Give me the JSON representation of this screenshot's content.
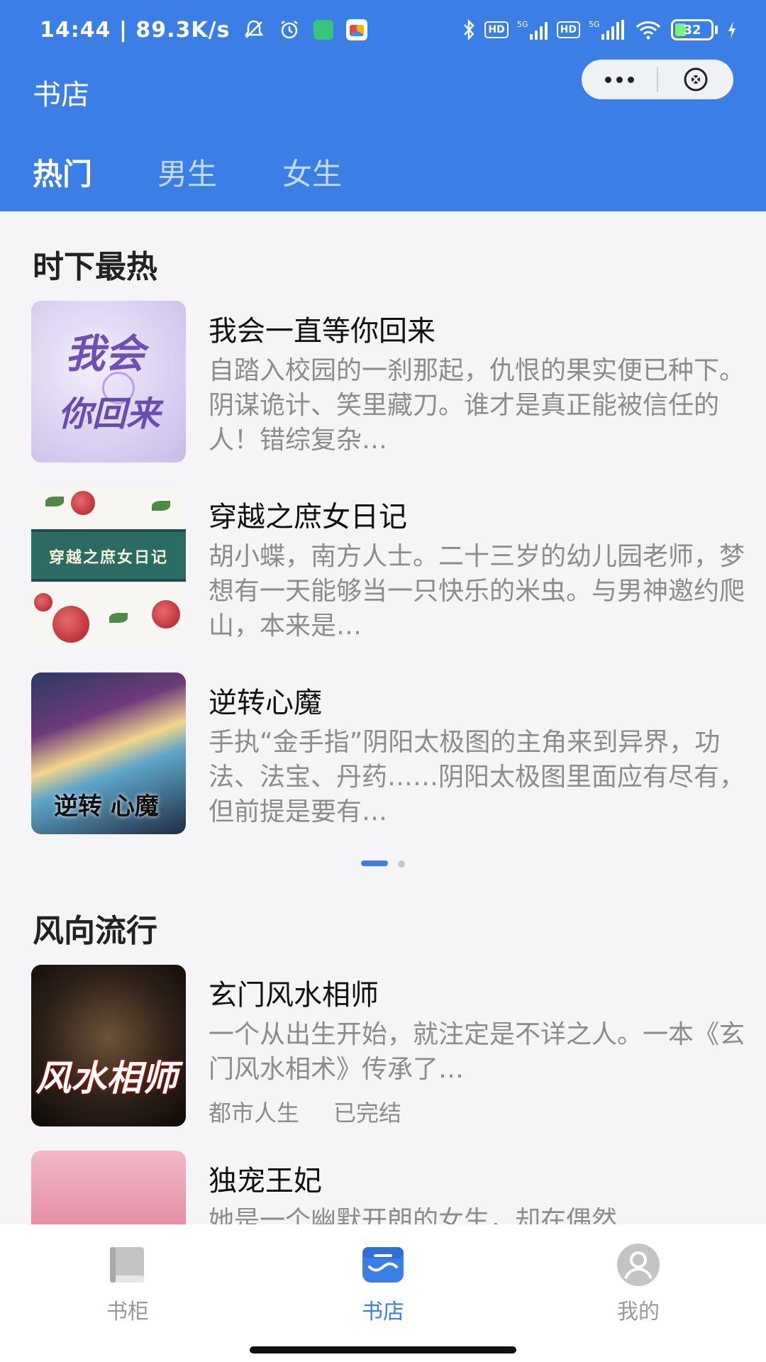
{
  "status_bar": {
    "time": "14:44",
    "speed": "89.3K/s",
    "battery": "32",
    "network_1": "5G",
    "network_2": "5G",
    "hd": "HD"
  },
  "header": {
    "title": "书店",
    "tabs": [
      "热门",
      "男生",
      "女生"
    ],
    "active_tab": "热门",
    "accent_color": "#3b7ee6"
  },
  "sections": [
    {
      "title": "时下最热",
      "books": [
        {
          "title": "我会一直等你回来",
          "description": "自踏入校园的一刹那起，仇恨的果实便已种下。阴谋诡计、笑里藏刀。谁才是真正能被信任的人！错综复杂…",
          "cover": {
            "line1": "我会",
            "line2": "你回来"
          }
        },
        {
          "title": "穿越之庶女日记",
          "description": "胡小蝶，南方人士。二十三岁的幼儿园老师，梦想有一天能够当一只快乐的米虫。与男神邀约爬山，本来是…",
          "cover": {
            "band": "穿越之庶女日记"
          }
        },
        {
          "title": "逆转心魔",
          "description": "手执“金手指”阴阳太极图的主角来到异界，功法、法宝、丹药……阴阳太极图里面应有尽有，但前提是要有…",
          "cover": {
            "label": "逆转 心魔"
          }
        }
      ],
      "pager": {
        "pages": 2,
        "current": 1
      }
    },
    {
      "title": "风向流行",
      "books": [
        {
          "title": "玄门风水相师",
          "description": "一个从出生开始，就注定是不详之人。一本《玄门风水相术》传承了…",
          "tags": [
            "都市人生",
            "已完结"
          ],
          "cover": {
            "label": "风水相师"
          }
        },
        {
          "title": "独宠王妃",
          "description": "她是一个幽默开朗的女生，却在偶然…"
        }
      ]
    }
  ],
  "bottom_nav": [
    {
      "label": "书柜",
      "icon": "bookshelf-icon",
      "active": false
    },
    {
      "label": "书店",
      "icon": "store-icon",
      "active": true
    },
    {
      "label": "我的",
      "icon": "profile-icon",
      "active": false
    }
  ]
}
